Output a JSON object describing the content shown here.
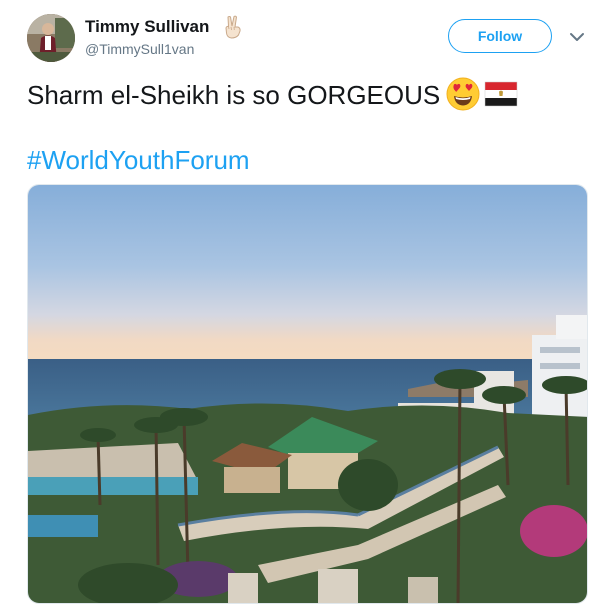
{
  "user": {
    "display_name": "Timmy Sullivan",
    "handle": "@TimmySull1van",
    "name_emoji": "victory-hand-icon"
  },
  "actions": {
    "follow_label": "Follow",
    "menu_icon": "chevron-down-icon"
  },
  "tweet": {
    "text": "Sharm el-Sheikh is so GORGEOUS",
    "emojis": [
      "heart-eyes-icon",
      "egypt-flag-icon"
    ],
    "hashtag": "#WorldYouthForum"
  },
  "colors": {
    "accent": "#1da1f2",
    "name_text": "#14171a",
    "secondary_text": "#657786"
  }
}
